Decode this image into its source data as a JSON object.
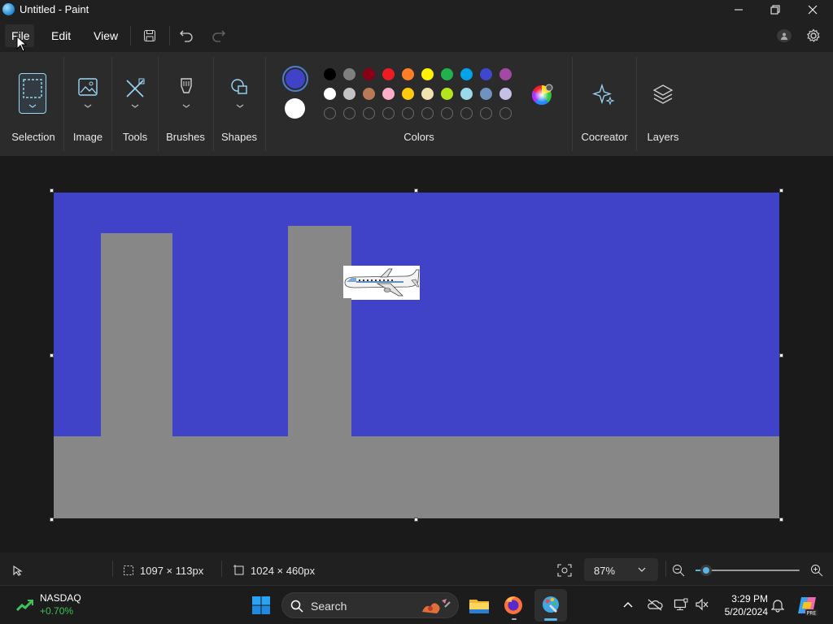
{
  "window": {
    "title": "Untitled - Paint"
  },
  "menu": {
    "file": "File",
    "edit": "Edit",
    "view": "View"
  },
  "ribbon": {
    "selection": "Selection",
    "image": "Image",
    "tools": "Tools",
    "brushes": "Brushes",
    "shapes": "Shapes",
    "colors": "Colors",
    "cocreator": "Cocreator",
    "layers": "Layers"
  },
  "colors": {
    "primary": "#4043c8",
    "secondary": "#ffffff",
    "row1": [
      "#000000",
      "#7f7f7f",
      "#880015",
      "#ed1c24",
      "#ff7f27",
      "#fff200",
      "#22b14c",
      "#00a2e8",
      "#3f48cc",
      "#a349a4"
    ],
    "row2": [
      "#ffffff",
      "#c3c3c3",
      "#b97a57",
      "#ffaec9",
      "#ffc90e",
      "#efe4b0",
      "#b5e61d",
      "#99d9ea",
      "#7092be",
      "#c8bfe7"
    ]
  },
  "status": {
    "selection_size": "1097 × 113px",
    "canvas_size": "1024 × 460px",
    "zoom": "87%",
    "zoom_level": 0.1
  },
  "taskbar": {
    "stock_name": "NASDAQ",
    "stock_change": "+0.70%",
    "search_placeholder": "Search",
    "time": "3:29 PM",
    "date": "5/20/2024"
  }
}
